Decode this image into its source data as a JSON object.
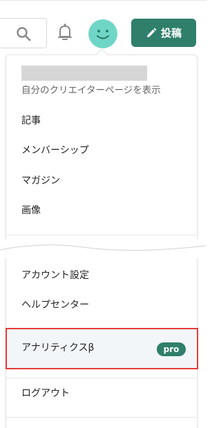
{
  "header": {
    "post_label": "投稿"
  },
  "menu": {
    "creator_page_link": "自分のクリエイターページを表示",
    "items_top": [
      {
        "label": "記事"
      },
      {
        "label": "メンバーシップ"
      },
      {
        "label": "マガジン"
      },
      {
        "label": "画像"
      }
    ],
    "items_bottom": [
      {
        "label": "アカウント設定"
      },
      {
        "label": "ヘルプセンター"
      }
    ],
    "analytics": {
      "label": "アナリティクスβ",
      "badge": "pro"
    },
    "logout": "ログアウト"
  },
  "colors": {
    "accent": "#2f7f6b",
    "avatar": "#6fd6c7",
    "highlight_border": "#e53b35"
  }
}
